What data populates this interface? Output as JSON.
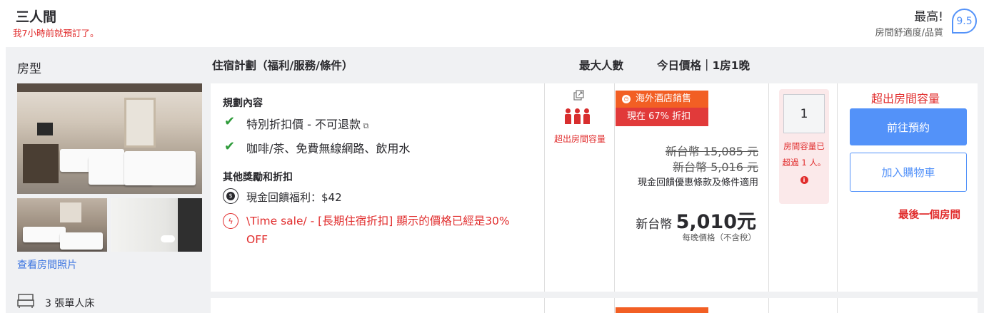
{
  "header": {
    "room_name": "三人間",
    "booked_note": "我7小時前就預訂了。",
    "score_label": "最高!",
    "score_sub": "房間舒適度/品質",
    "score": "9.5"
  },
  "table_header": {
    "room_type": "房型",
    "plan": "住宿計劃（福利/服務/條件）",
    "max_guests": "最大人數",
    "today_price": "今日價格｜1房1晚"
  },
  "room": {
    "view_photos": "查看房間照片",
    "bed_info": "3 張單人床"
  },
  "plan": {
    "title": "規劃內容",
    "features": [
      "特別折扣價 - 不可退款",
      "咖啡/茶、免費無線網路、飲用水"
    ],
    "other_title": "其他獎勵和折扣",
    "cashback": "現金回饋福利：$42",
    "sale_text": "\\Time sale/ - [長期住宿折扣] 顯示的價格已經是30% OFF"
  },
  "occupancy": {
    "note": "超出房間容量"
  },
  "price": {
    "tag_overseas": "海外酒店銷售",
    "tag_discount": "現在 67% 折扣",
    "original": "新台幣 15,085 元",
    "crossed": "新台幣 5,016 元",
    "cashback_terms": "現金回饋優惠條款及條件適用",
    "final_prefix": "新台幣",
    "final_amount": "5,010元",
    "per_night": "每晚價格（不含稅）"
  },
  "rooms_select": {
    "value": "1",
    "warning": "房間容量已超過 1 人。"
  },
  "actions": {
    "exceed": "超出房間容量",
    "book": "前往預約",
    "cart": "加入購物車",
    "last_room": "最後一個房間"
  },
  "colors": {
    "accent_blue": "#5392f9",
    "alert_red": "#e12d2d",
    "sale_orange": "#f25f24",
    "check_green": "#2e9b3a"
  }
}
